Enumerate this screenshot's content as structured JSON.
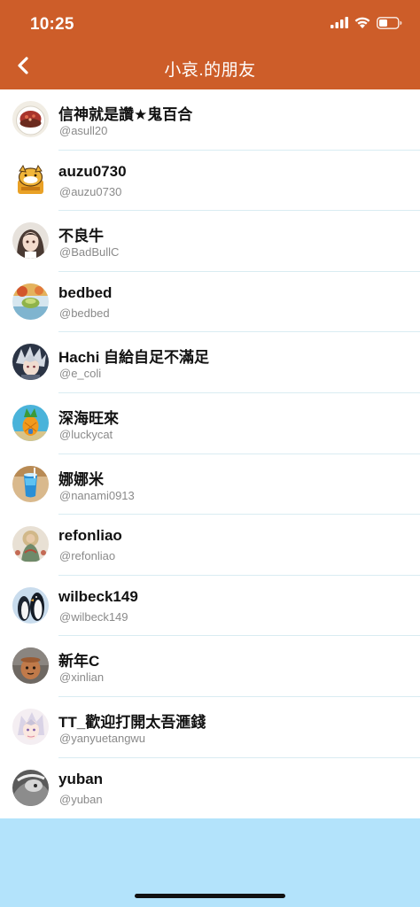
{
  "status_bar": {
    "time": "10:25",
    "icons": [
      "cellular-signal-icon",
      "wifi-icon",
      "battery-icon"
    ]
  },
  "nav": {
    "back_icon": "chevron-left-icon",
    "title": "小哀.的朋友"
  },
  "colors": {
    "header_bg": "#cd5d29",
    "list_bg": "#ffffff",
    "page_bg": "#b3e3fb",
    "divider": "#d9ecf2"
  },
  "friends": [
    {
      "name": "信神就是讚★鬼百合",
      "handle": "@asull20"
    },
    {
      "name": "auzu0730",
      "handle": "@auzu0730"
    },
    {
      "name": "不良牛",
      "handle": "@BadBullC"
    },
    {
      "name": "bedbed",
      "handle": "@bedbed"
    },
    {
      "name": "Hachi 自給自足不滿足",
      "handle": "@e_coli"
    },
    {
      "name": "深海旺來",
      "handle": "@luckycat"
    },
    {
      "name": "娜娜米",
      "handle": "@nanami0913"
    },
    {
      "name": "refonliao",
      "handle": "@refonliao"
    },
    {
      "name": "wilbeck149",
      "handle": "@wilbeck149"
    },
    {
      "name": "新年C",
      "handle": "@xinlian"
    },
    {
      "name": "TT_歡迎打開太吾滙錢",
      "handle": "@yanyuetangwu"
    },
    {
      "name": "yuban",
      "handle": "@yuban"
    }
  ]
}
